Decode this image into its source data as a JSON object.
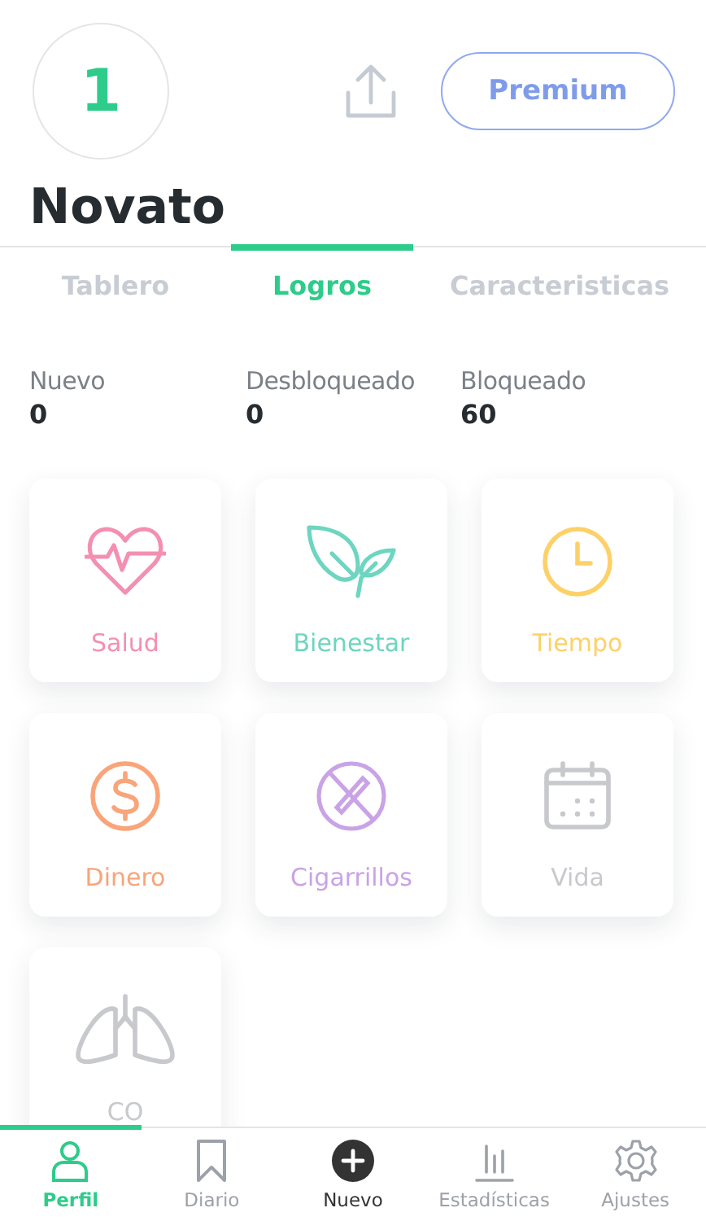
{
  "header": {
    "level": "1",
    "premium_button": "Premium",
    "title": "Novato"
  },
  "tabs": [
    {
      "label": "Tablero",
      "selected": false
    },
    {
      "label": "Logros",
      "selected": true
    },
    {
      "label": "Caracteristicas",
      "selected": false
    }
  ],
  "stats": [
    {
      "label": "Nuevo",
      "value": "0"
    },
    {
      "label": "Desbloqueado",
      "value": "0"
    },
    {
      "label": "Bloqueado",
      "value": "60"
    }
  ],
  "categories": [
    {
      "label": "Salud",
      "kind": "heart",
      "color": "#f48fb1"
    },
    {
      "label": "Bienestar",
      "kind": "leaf",
      "color": "#6dd5c0"
    },
    {
      "label": "Tiempo",
      "kind": "clock",
      "color": "#fdd168"
    },
    {
      "label": "Dinero",
      "kind": "dollar",
      "color": "#f9a479"
    },
    {
      "label": "Cigarrillos",
      "kind": "nosmoke",
      "color": "#c9a3e6"
    },
    {
      "label": "Vida",
      "kind": "calendar",
      "color": "#c8c9cd"
    },
    {
      "label": "CO",
      "kind": "lungs",
      "color": "#c8c9cd"
    }
  ],
  "nav": [
    {
      "label": "Perfil",
      "kind": "person",
      "selected": true
    },
    {
      "label": "Diario",
      "kind": "bookmark",
      "selected": false
    },
    {
      "label": "Nuevo",
      "kind": "add",
      "selected": false
    },
    {
      "label": "Estadísticas",
      "kind": "bars",
      "selected": false
    },
    {
      "label": "Ajustes",
      "kind": "gear",
      "selected": false
    }
  ]
}
